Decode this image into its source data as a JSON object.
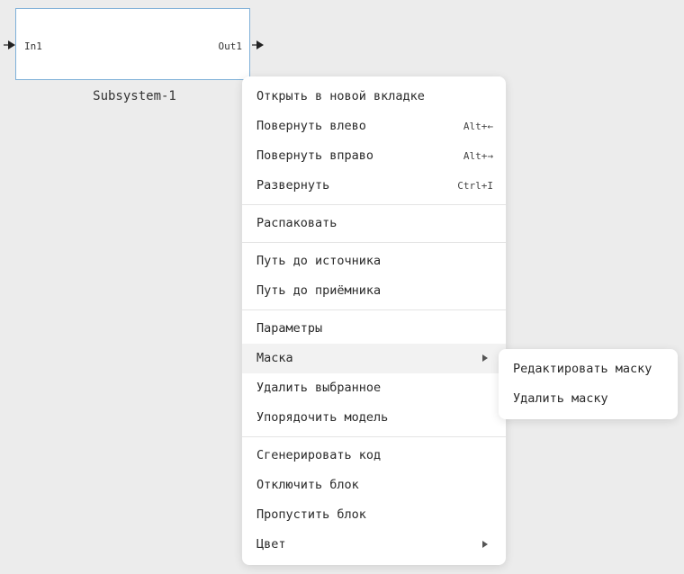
{
  "block": {
    "input_port": "In1",
    "output_port": "Out1",
    "title": "Subsystem-1"
  },
  "menu": {
    "groups": [
      [
        {
          "label": "Открыть в новой вкладке",
          "shortcut": ""
        },
        {
          "label": "Повернуть влево",
          "shortcut": "Alt+←"
        },
        {
          "label": "Повернуть вправо",
          "shortcut": "Alt+→"
        },
        {
          "label": "Развернуть",
          "shortcut": "Ctrl+I"
        }
      ],
      [
        {
          "label": "Распаковать",
          "shortcut": ""
        }
      ],
      [
        {
          "label": "Путь до источника",
          "shortcut": ""
        },
        {
          "label": "Путь до приёмника",
          "shortcut": ""
        }
      ],
      [
        {
          "label": "Параметры",
          "shortcut": ""
        },
        {
          "label": "Маска",
          "shortcut": "",
          "submenu": true,
          "hovered": true
        },
        {
          "label": "Удалить выбранное",
          "shortcut": ""
        },
        {
          "label": "Упорядочить модель",
          "shortcut": ""
        }
      ],
      [
        {
          "label": "Сгенерировать код",
          "shortcut": ""
        },
        {
          "label": "Отключить блок",
          "shortcut": ""
        },
        {
          "label": "Пропустить блок",
          "shortcut": ""
        },
        {
          "label": "Цвет",
          "shortcut": "",
          "submenu": true
        }
      ]
    ]
  },
  "submenu": {
    "items": [
      "Редактировать маску",
      "Удалить маску"
    ]
  },
  "colors": {
    "canvas_bg": "#ececec",
    "block_border": "#7fb0d8",
    "hover_bg": "#f2f2f2"
  }
}
